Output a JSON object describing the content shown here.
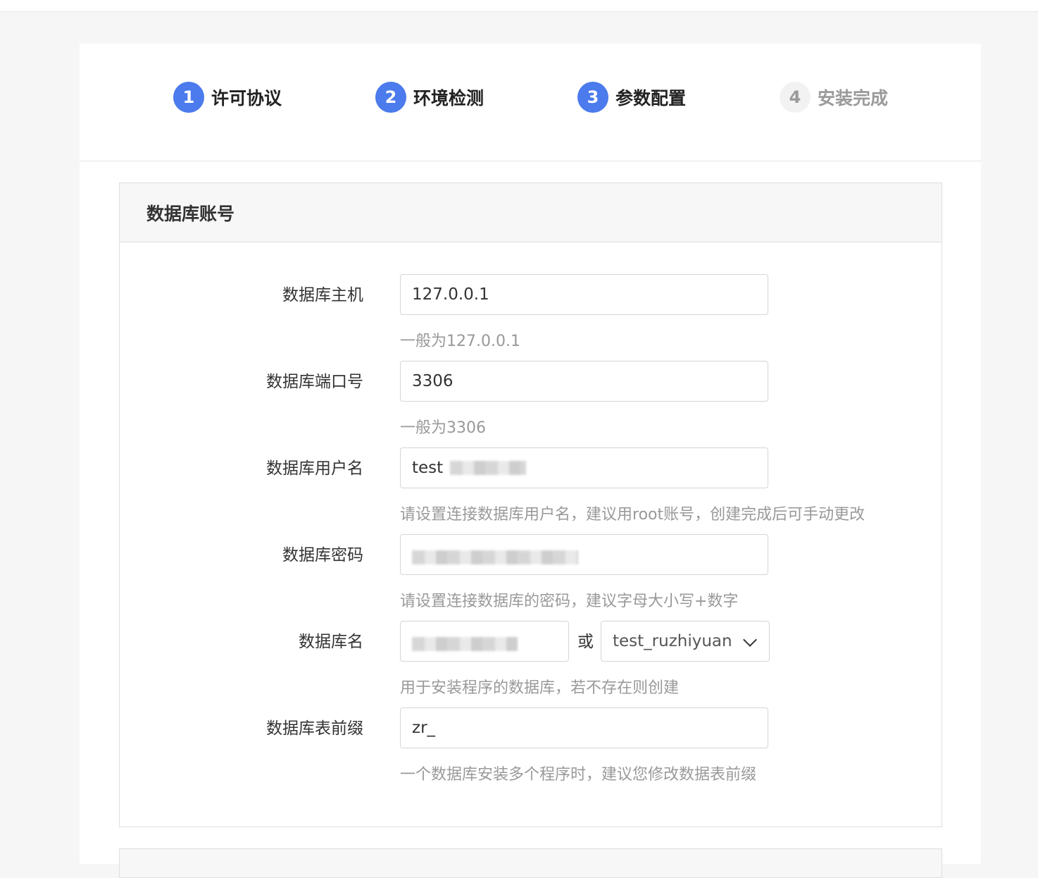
{
  "steps": [
    {
      "num": "1",
      "label": "许可协议",
      "state": "done"
    },
    {
      "num": "2",
      "label": "环境检测",
      "state": "done"
    },
    {
      "num": "3",
      "label": "参数配置",
      "state": "active"
    },
    {
      "num": "4",
      "label": "安装完成",
      "state": "pending"
    }
  ],
  "panel": {
    "title": "数据库账号",
    "fields": {
      "host": {
        "label": "数据库主机",
        "value": "127.0.0.1",
        "hint": "一般为127.0.0.1"
      },
      "port": {
        "label": "数据库端口号",
        "value": "3306",
        "hint": "一般为3306"
      },
      "user": {
        "label": "数据库用户名",
        "value": "test",
        "hint": "请设置连接数据库用户名，建议用root账号，创建完成后可手动更改"
      },
      "password": {
        "label": "数据库密码",
        "value": "",
        "hint": "请设置连接数据库的密码，建议字母大小写+数字"
      },
      "dbname": {
        "label": "数据库名",
        "value": "",
        "or_text": "或",
        "select_value": "test_ruzhiyuan",
        "hint": "用于安装程序的数据库，若不存在则创建"
      },
      "prefix": {
        "label": "数据库表前缀",
        "value": "zr_",
        "hint": "一个数据库安装多个程序时，建议您修改数据表前缀"
      }
    }
  },
  "icons": {
    "select_arrow": "chevron-down-icon"
  },
  "colors": {
    "accent": "#4b7bec",
    "pending": "#9a9a9a"
  }
}
